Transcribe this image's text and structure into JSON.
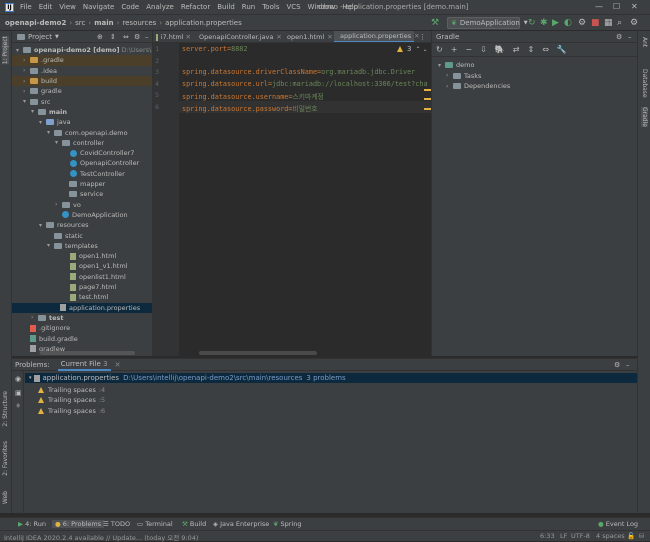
{
  "menu": [
    "File",
    "Edit",
    "View",
    "Navigate",
    "Code",
    "Analyze",
    "Refactor",
    "Build",
    "Run",
    "Tools",
    "VCS",
    "Window",
    "Help"
  ],
  "window_title": "demo - application.properties [demo.main]",
  "breadcrumbs": [
    "openapi-demo2",
    "src",
    "main",
    "resources",
    "application.properties"
  ],
  "run_config": "DemoApplication",
  "project_panel": {
    "title": "Project",
    "items": [
      {
        "label": "openapi-demo2 [demo]",
        "suffix": "D:\\Users\\intelli"
      },
      {
        "label": ".gradle"
      },
      {
        "label": ".idea"
      },
      {
        "label": "build"
      },
      {
        "label": "gradle"
      },
      {
        "label": "src"
      },
      {
        "label": "main"
      },
      {
        "label": "java"
      },
      {
        "label": "com.openapi.demo"
      },
      {
        "label": "controller"
      },
      {
        "label": "CovidController7"
      },
      {
        "label": "OpenapiController"
      },
      {
        "label": "TestController"
      },
      {
        "label": "mapper"
      },
      {
        "label": "service"
      },
      {
        "label": "vo"
      },
      {
        "label": "DemoApplication"
      },
      {
        "label": "resources"
      },
      {
        "label": "static"
      },
      {
        "label": "templates"
      },
      {
        "label": "open1.html"
      },
      {
        "label": "open1_v1.html"
      },
      {
        "label": "openlist1.html"
      },
      {
        "label": "page7.html"
      },
      {
        "label": "test.html"
      },
      {
        "label": "application.properties"
      },
      {
        "label": "test"
      },
      {
        "label": ".gitignore"
      },
      {
        "label": "build.gradle"
      },
      {
        "label": "gradlew"
      }
    ]
  },
  "editor_tabs": [
    "i7.html",
    "OpenapiController.java",
    "open1.html",
    "application.properties"
  ],
  "editor": {
    "warnings": "3",
    "lines": [
      {
        "n": "1",
        "key": "server.port",
        "eq": "=",
        "val": "8882"
      },
      {
        "n": "2",
        "key": "",
        "eq": "",
        "val": ""
      },
      {
        "n": "3",
        "key": "spring.datasource.driverClassName",
        "eq": "=",
        "val": "org.mariadb.jdbc.Driver"
      },
      {
        "n": "4",
        "key": "spring.datasource.url",
        "eq": "=",
        "val": "jdbc:mariadb://localhost:3306/test?cha"
      },
      {
        "n": "5",
        "key": "spring.datasource.username",
        "eq": "=",
        "val": "스키마계정"
      },
      {
        "n": "6",
        "key": "spring.datasource.password",
        "eq": "=",
        "val": "비밀번호"
      }
    ]
  },
  "gradle_panel": {
    "title": "Gradle",
    "root": "demo",
    "children": [
      "Tasks",
      "Dependencies"
    ]
  },
  "right_tabs": [
    "Ant",
    "Database",
    "Gradle"
  ],
  "left_tabs": [
    "1: Project",
    "2: Structure",
    "2: Favorites",
    "Web"
  ],
  "problems": {
    "tab1": "Problems:",
    "tab2": "Current File",
    "count": "3",
    "file": "application.properties",
    "path": "D:\\Users\\intellij\\openapi-demo2\\src\\main\\resources",
    "problems_count": "3 problems",
    "items": [
      {
        "label": "Trailing spaces",
        "line": ":4"
      },
      {
        "label": "Trailing spaces",
        "line": ":5"
      },
      {
        "label": "Trailing spaces",
        "line": ":6"
      }
    ]
  },
  "bottom_tools": [
    "4: Run",
    "6: Problems",
    "TODO",
    "Terminal",
    "Build",
    "Java Enterprise",
    "Spring"
  ],
  "event_log": "Event Log",
  "status": {
    "message": "IntelliJ IDEA 2020.2.4 available // Update... (today 오전 9:04)",
    "position": "6:33",
    "line_sep": "LF",
    "encoding": "UTF-8",
    "indent": "4 spaces"
  },
  "colors": {
    "accent": "#4a88c7",
    "warning": "#e2b342",
    "keyword": "#cc7832",
    "value": "#6a8759"
  }
}
